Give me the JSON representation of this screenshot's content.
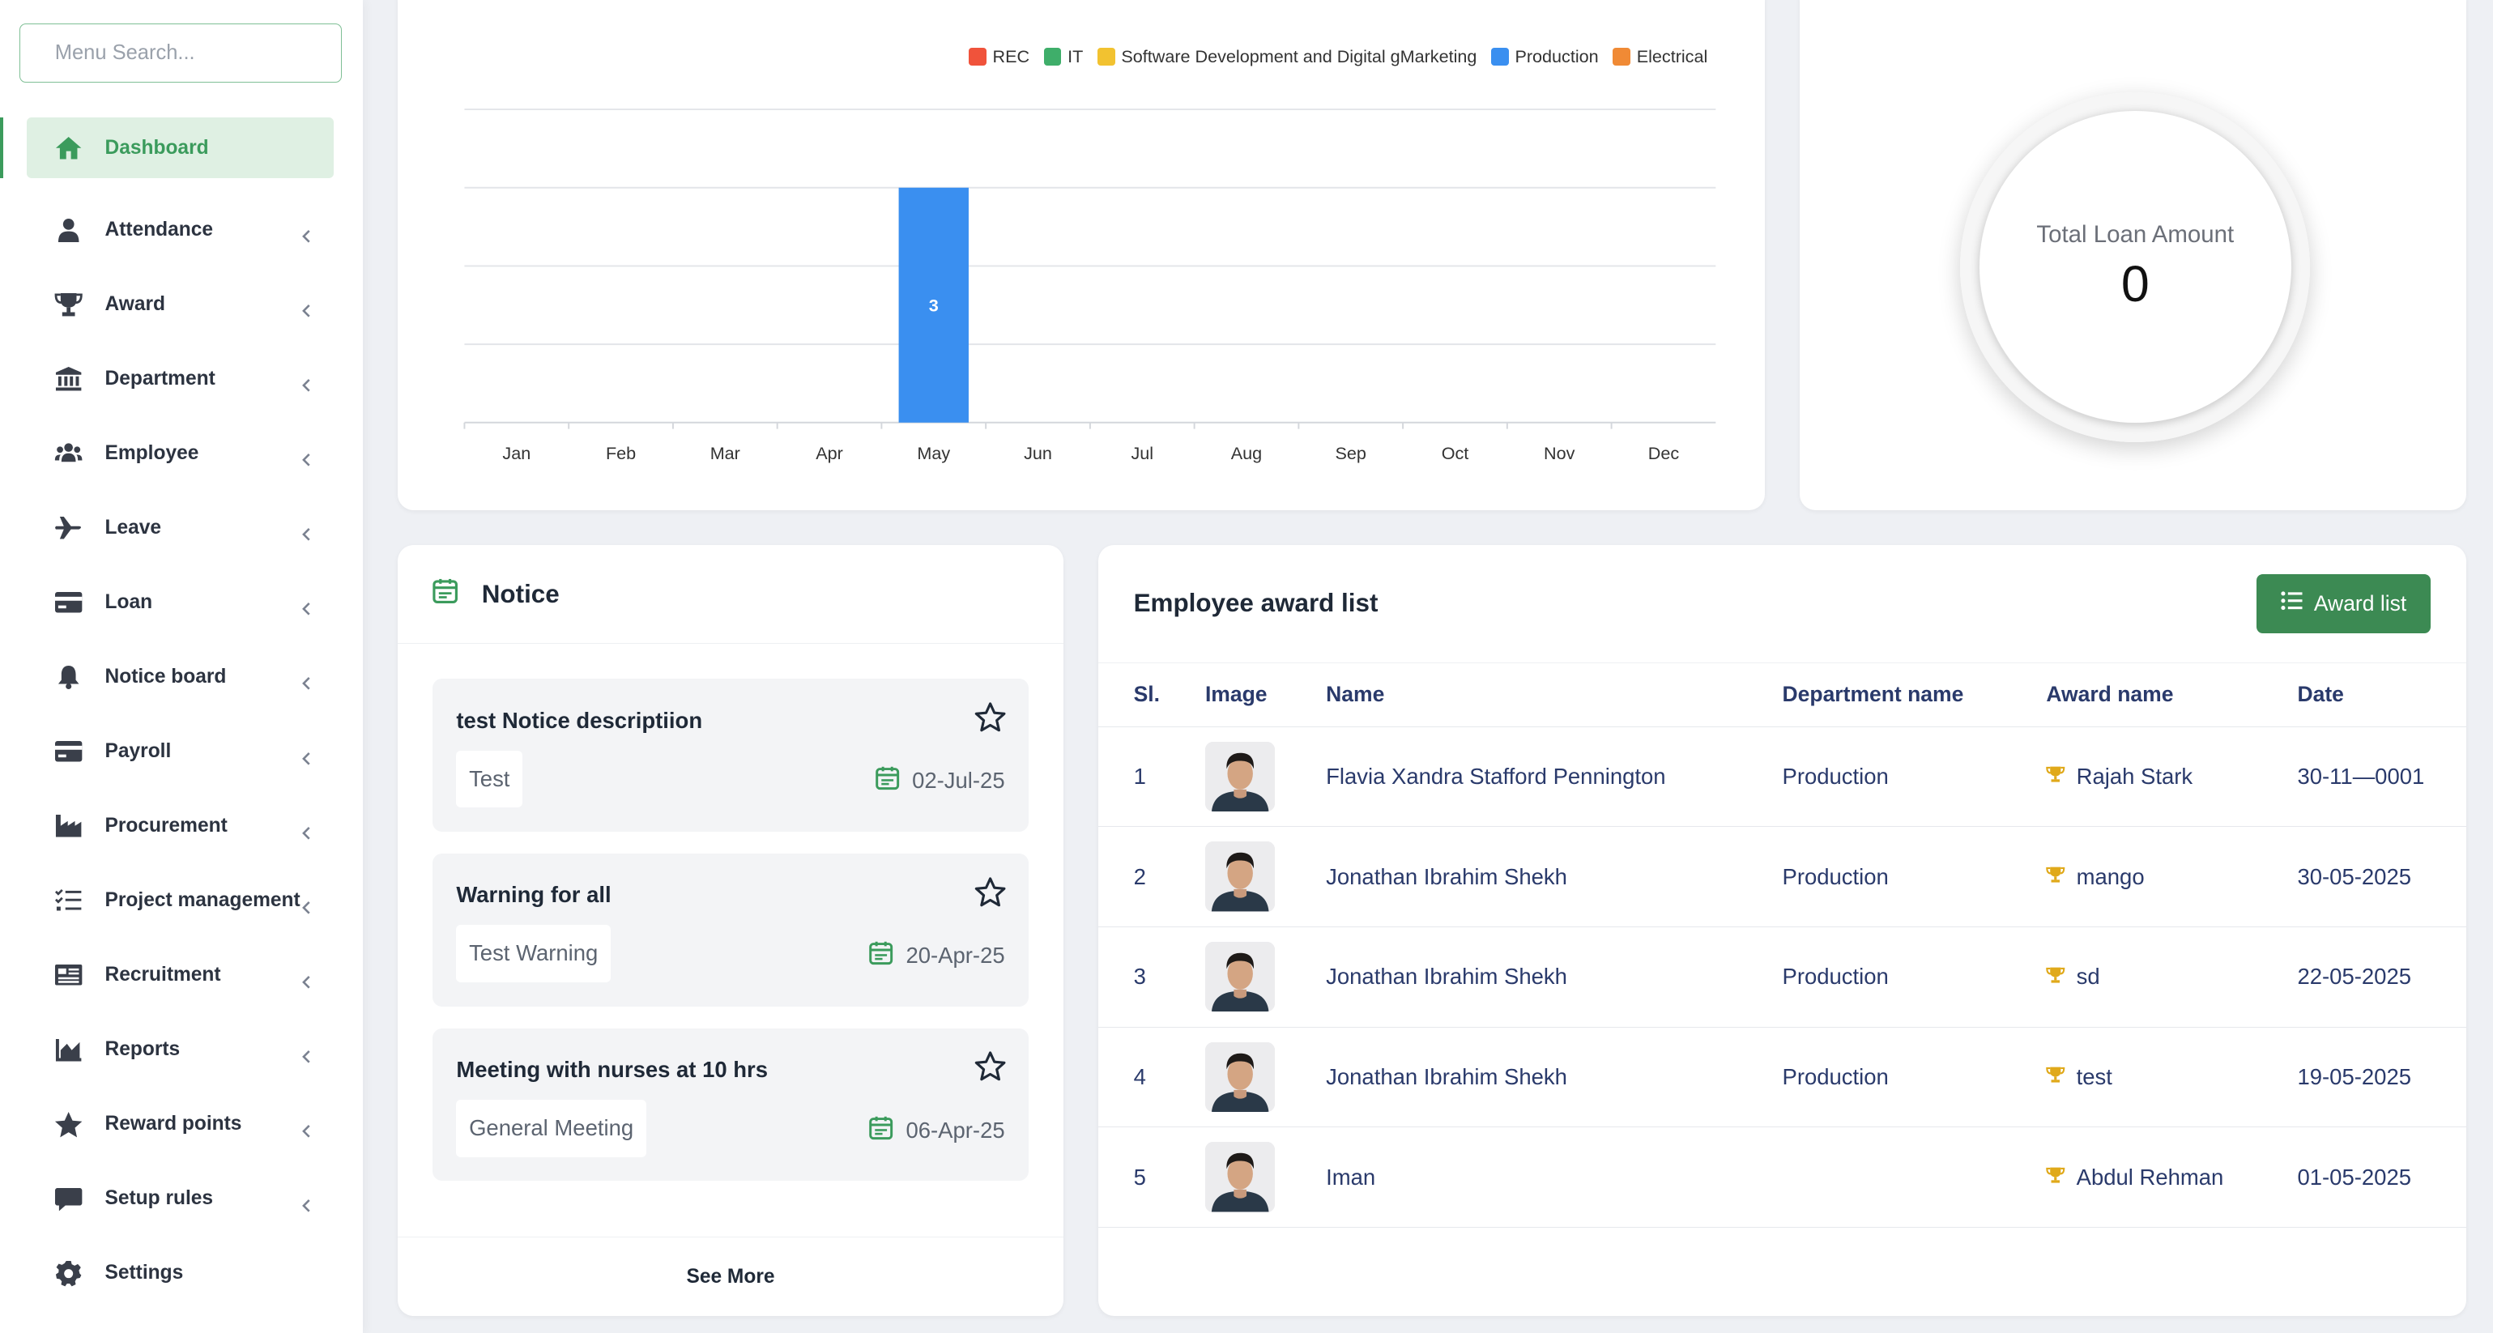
{
  "colors": {
    "accent": "#3b9b5c",
    "button": "#3c8a53",
    "table_text": "#2a3a6b"
  },
  "sidebar": {
    "search_placeholder": "Menu Search...",
    "items": [
      {
        "label": "Dashboard",
        "icon": "home-icon",
        "active": true
      },
      {
        "label": "Attendance",
        "icon": "user-icon"
      },
      {
        "label": "Award",
        "icon": "trophy-icon"
      },
      {
        "label": "Department",
        "icon": "bank-icon"
      },
      {
        "label": "Employee",
        "icon": "users-icon"
      },
      {
        "label": "Leave",
        "icon": "plane-icon"
      },
      {
        "label": "Loan",
        "icon": "credit-card-icon"
      },
      {
        "label": "Notice board",
        "icon": "bell-icon"
      },
      {
        "label": "Payroll",
        "icon": "wallet-icon"
      },
      {
        "label": "Procurement",
        "icon": "factory-icon"
      },
      {
        "label": "Project management",
        "icon": "tasks-icon"
      },
      {
        "label": "Recruitment",
        "icon": "news-icon"
      },
      {
        "label": "Reports",
        "icon": "chart-icon"
      },
      {
        "label": "Reward points",
        "icon": "star-icon"
      },
      {
        "label": "Setup rules",
        "icon": "comment-icon"
      },
      {
        "label": "Settings",
        "icon": "gear-icon"
      }
    ]
  },
  "chart_data": {
    "type": "bar",
    "categories": [
      "Jan",
      "Feb",
      "Mar",
      "Apr",
      "May",
      "Jun",
      "Jul",
      "Aug",
      "Sep",
      "Oct",
      "Nov",
      "Dec"
    ],
    "series": [
      {
        "name": "REC",
        "color": "#f0533b",
        "values": [
          0,
          0,
          0,
          0,
          0,
          0,
          0,
          0,
          0,
          0,
          0,
          0
        ]
      },
      {
        "name": "IT",
        "color": "#3fae6a",
        "values": [
          0,
          0,
          0,
          0,
          0,
          0,
          0,
          0,
          0,
          0,
          0,
          0
        ]
      },
      {
        "name": "Software Development and Digital gMarketing",
        "color": "#f2c230",
        "values": [
          0,
          0,
          0,
          0,
          0,
          0,
          0,
          0,
          0,
          0,
          0,
          0
        ]
      },
      {
        "name": "Production",
        "color": "#3a8ff0",
        "values": [
          0,
          0,
          0,
          0,
          3,
          0,
          0,
          0,
          0,
          0,
          0,
          0
        ]
      },
      {
        "name": "Electrical",
        "color": "#f08a35",
        "values": [
          0,
          0,
          0,
          0,
          0,
          0,
          0,
          0,
          0,
          0,
          0,
          0
        ]
      }
    ],
    "ylim": [
      0,
      4
    ],
    "grid": true,
    "legend": "top-right",
    "data_labels": true
  },
  "loan": {
    "title": "Total Loan Amount",
    "value": "0"
  },
  "notice": {
    "title": "Notice",
    "items": [
      {
        "title": "test Notice descriptiion",
        "tag": "Test",
        "date": "02-Jul-25"
      },
      {
        "title": "Warning for all",
        "tag": "Test Warning",
        "date": "20-Apr-25"
      },
      {
        "title": "Meeting with nurses at 10 hrs",
        "tag": "General Meeting",
        "date": "06-Apr-25"
      }
    ],
    "see_more": "See More"
  },
  "awards": {
    "title": "Employee award list",
    "button_label": "Award list",
    "columns": [
      "Sl.",
      "Image",
      "Name",
      "Department name",
      "Award name",
      "Date"
    ],
    "rows": [
      {
        "sl": "1",
        "name": "Flavia Xandra Stafford Pennington",
        "department": "Production",
        "award": "Rajah Stark",
        "date": "30-11—0001"
      },
      {
        "sl": "2",
        "name": "Jonathan Ibrahim Shekh",
        "department": "Production",
        "award": "mango",
        "date": "30-05-2025"
      },
      {
        "sl": "3",
        "name": "Jonathan Ibrahim Shekh",
        "department": "Production",
        "award": "sd",
        "date": "22-05-2025"
      },
      {
        "sl": "4",
        "name": "Jonathan Ibrahim Shekh",
        "department": "Production",
        "award": "test",
        "date": "19-05-2025"
      },
      {
        "sl": "5",
        "name": "Iman",
        "department": "",
        "award": "Abdul Rehman",
        "date": "01-05-2025"
      }
    ]
  }
}
